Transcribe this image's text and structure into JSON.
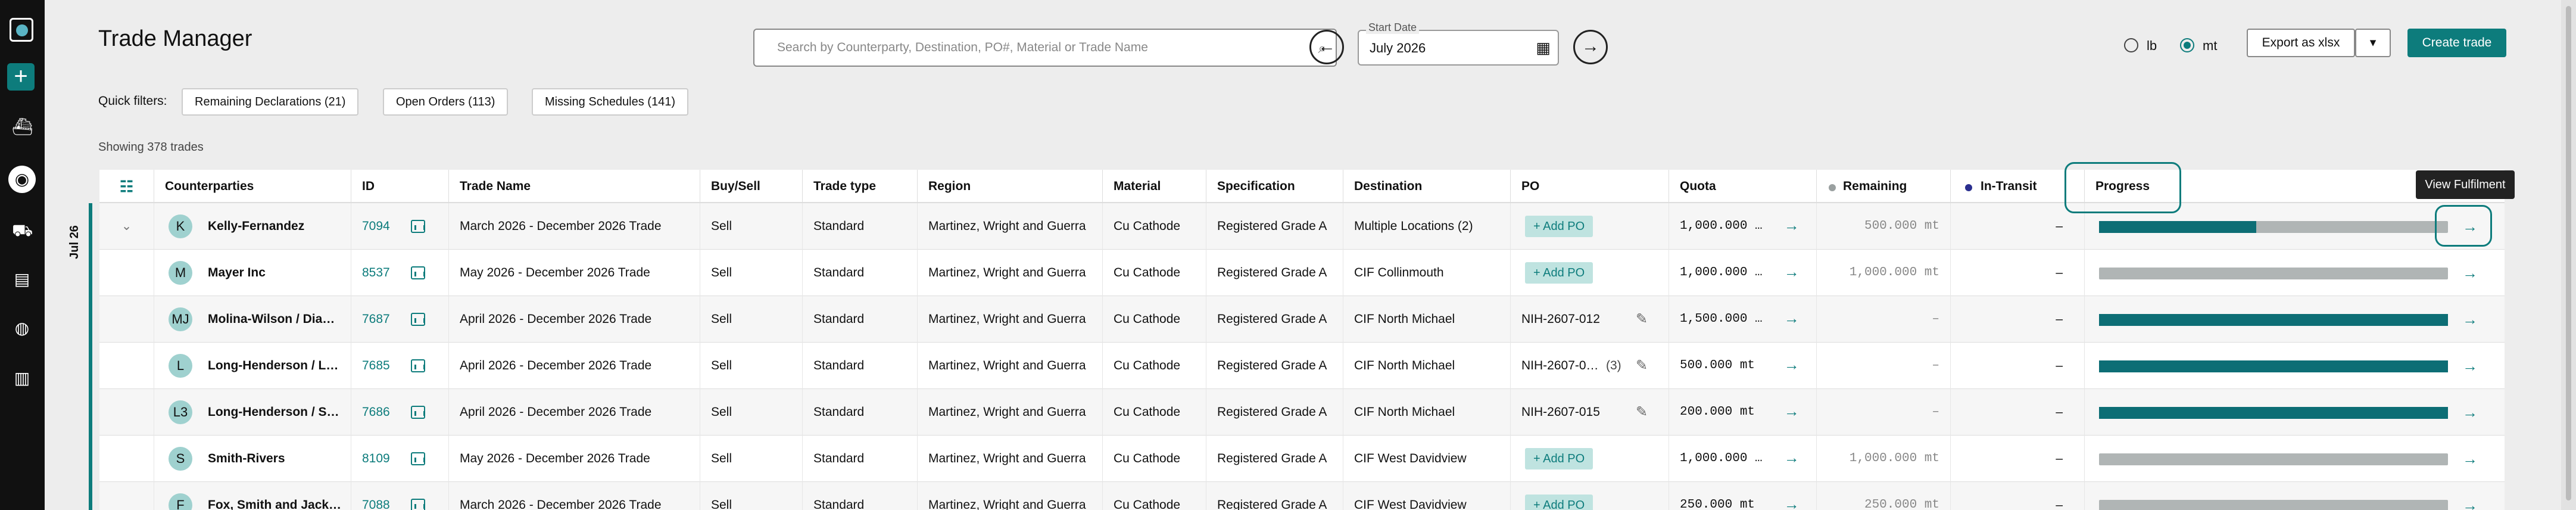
{
  "page": {
    "title": "Trade Manager",
    "showing": "Showing 378 trades"
  },
  "search": {
    "placeholder": "Search by Counterparty, Destination, PO#, Material or Trade Name"
  },
  "date": {
    "label": "Start Date",
    "value": "July 2026"
  },
  "units": {
    "lb": "lb",
    "mt": "mt",
    "selected": "mt"
  },
  "actions": {
    "export": "Export as xlsx",
    "create": "Create trade"
  },
  "quick_filters": {
    "label": "Quick filters:",
    "chips": [
      "Remaining Declarations (21)",
      "Open Orders (113)",
      "Missing Schedules (141)"
    ]
  },
  "table": {
    "group_label": "Jul 26",
    "columns": [
      "Counterparties",
      "ID",
      "Trade Name",
      "Buy/Sell",
      "Trade type",
      "Region",
      "Material",
      "Specification",
      "Destination",
      "PO",
      "Quota",
      "Remaining",
      "In-Transit",
      "Progress"
    ],
    "tooltip": "View Fulfilment",
    "rows": [
      {
        "avatar": "K",
        "counterparty": "Kelly-Fernandez",
        "id": "7094",
        "trade_name": "March 2026 - December 2026 Trade",
        "buy_sell": "Sell",
        "type": "Standard",
        "region": "Martinez, Wright and Guerra",
        "material": "Cu Cathode",
        "spec": "Registered Grade A",
        "destination": "Multiple Locations (2)",
        "po": "Add PO",
        "quota": "1,000.000 …",
        "remaining": "500.000 mt",
        "in_transit": "–",
        "progress": 0.45
      },
      {
        "avatar": "M",
        "counterparty": "Mayer Inc",
        "id": "8537",
        "trade_name": "May 2026 - December 2026 Trade",
        "buy_sell": "Sell",
        "type": "Standard",
        "region": "Martinez, Wright and Guerra",
        "material": "Cu Cathode",
        "spec": "Registered Grade A",
        "destination": "CIF Collinmouth",
        "po": "Add PO",
        "quota": "1,000.000 …",
        "remaining": "1,000.000 mt",
        "in_transit": "–",
        "progress": 0
      },
      {
        "avatar": "MJ",
        "counterparty": "Molina-Wilson / Dia…",
        "id": "7687",
        "trade_name": "April 2026 - December 2026 Trade",
        "buy_sell": "Sell",
        "type": "Standard",
        "region": "Martinez, Wright and Guerra",
        "material": "Cu Cathode",
        "spec": "Registered Grade A",
        "destination": "CIF North Michael",
        "po": "NIH-2607-012",
        "quota": "1,500.000 …",
        "remaining": "–",
        "in_transit": "–",
        "progress": 1
      },
      {
        "avatar": "L",
        "counterparty": "Long-Henderson / L…",
        "id": "7685",
        "trade_name": "April 2026 - December 2026 Trade",
        "buy_sell": "Sell",
        "type": "Standard",
        "region": "Martinez, Wright and Guerra",
        "material": "Cu Cathode",
        "spec": "Registered Grade A",
        "destination": "CIF North Michael",
        "po": "NIH-2607-0…",
        "po_count": "(3)",
        "quota": "500.000 mt",
        "remaining": "–",
        "in_transit": "–",
        "progress": 1
      },
      {
        "avatar": "L3",
        "counterparty": "Long-Henderson / S…",
        "id": "7686",
        "trade_name": "April 2026 - December 2026 Trade",
        "buy_sell": "Sell",
        "type": "Standard",
        "region": "Martinez, Wright and Guerra",
        "material": "Cu Cathode",
        "spec": "Registered Grade A",
        "destination": "CIF North Michael",
        "po": "NIH-2607-015",
        "quota": "200.000 mt",
        "remaining": "–",
        "in_transit": "–",
        "progress": 1
      },
      {
        "avatar": "S",
        "counterparty": "Smith-Rivers",
        "id": "8109",
        "trade_name": "May 2026 - December 2026 Trade",
        "buy_sell": "Sell",
        "type": "Standard",
        "region": "Martinez, Wright and Guerra",
        "material": "Cu Cathode",
        "spec": "Registered Grade A",
        "destination": "CIF West Davidview",
        "po": "Add PO",
        "quota": "1,000.000 …",
        "remaining": "1,000.000 mt",
        "in_transit": "–",
        "progress": 0
      },
      {
        "avatar": "F",
        "counterparty": "Fox, Smith and Jack…",
        "id": "7088",
        "trade_name": "March 2026 - December 2026 Trade",
        "buy_sell": "Sell",
        "type": "Standard",
        "region": "Martinez, Wright and Guerra",
        "material": "Cu Cathode",
        "spec": "Registered Grade A",
        "destination": "CIF West Davidview",
        "po": "Add PO",
        "quota": "250.000 mt",
        "remaining": "250.000 mt",
        "in_transit": "–",
        "progress": 0
      }
    ]
  },
  "colors": {
    "accent": "#0d7c7c",
    "progress_fill": "#0d6e75",
    "progress_track": "#b0b5b5",
    "in_transit_dot": "#2a2f8f",
    "remaining_dot": "#9aa0a0"
  }
}
